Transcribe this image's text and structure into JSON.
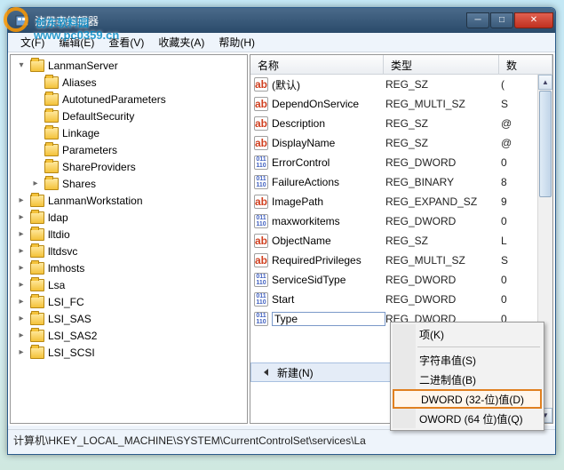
{
  "watermark": {
    "brand": "创东软料园",
    "url": "www.pc0359.cn"
  },
  "window": {
    "title": "注册表编辑器"
  },
  "menu": {
    "file": "文(F)",
    "edit": "编辑(E)",
    "view": "查看(V)",
    "favorites": "收藏夹(A)",
    "help": "帮助(H)"
  },
  "tree": [
    {
      "label": "LanmanServer",
      "exp": "▾",
      "cls": ""
    },
    {
      "label": "Aliases",
      "exp": "",
      "cls": "noexp",
      "indent": 1
    },
    {
      "label": "AutotunedParameters",
      "exp": "",
      "cls": "noexp",
      "indent": 1
    },
    {
      "label": "DefaultSecurity",
      "exp": "",
      "cls": "noexp",
      "indent": 1
    },
    {
      "label": "Linkage",
      "exp": "",
      "cls": "noexp",
      "indent": 1
    },
    {
      "label": "Parameters",
      "exp": "",
      "cls": "noexp",
      "indent": 1
    },
    {
      "label": "ShareProviders",
      "exp": "",
      "cls": "noexp",
      "indent": 1
    },
    {
      "label": "Shares",
      "exp": "▸",
      "cls": "",
      "indent": 1
    },
    {
      "label": "LanmanWorkstation",
      "exp": "▸",
      "cls": ""
    },
    {
      "label": "ldap",
      "exp": "▸",
      "cls": ""
    },
    {
      "label": "lltdio",
      "exp": "▸",
      "cls": ""
    },
    {
      "label": "lltdsvc",
      "exp": "▸",
      "cls": ""
    },
    {
      "label": "lmhosts",
      "exp": "▸",
      "cls": ""
    },
    {
      "label": "Lsa",
      "exp": "▸",
      "cls": ""
    },
    {
      "label": "LSI_FC",
      "exp": "▸",
      "cls": ""
    },
    {
      "label": "LSI_SAS",
      "exp": "▸",
      "cls": ""
    },
    {
      "label": "LSI_SAS2",
      "exp": "▸",
      "cls": ""
    },
    {
      "label": "LSI_SCSI",
      "exp": "▸",
      "cls": ""
    }
  ],
  "listheader": {
    "name": "名称",
    "type": "类型",
    "data": "数"
  },
  "rows": [
    {
      "icon": "ab",
      "name": "(默认)",
      "type": "REG_SZ",
      "data": "("
    },
    {
      "icon": "ab",
      "name": "DependOnService",
      "type": "REG_MULTI_SZ",
      "data": "S"
    },
    {
      "icon": "ab",
      "name": "Description",
      "type": "REG_SZ",
      "data": "@"
    },
    {
      "icon": "ab",
      "name": "DisplayName",
      "type": "REG_SZ",
      "data": "@"
    },
    {
      "icon": "bi",
      "name": "ErrorControl",
      "type": "REG_DWORD",
      "data": "0"
    },
    {
      "icon": "bi",
      "name": "FailureActions",
      "type": "REG_BINARY",
      "data": "8"
    },
    {
      "icon": "ab",
      "name": "ImagePath",
      "type": "REG_EXPAND_SZ",
      "data": "9"
    },
    {
      "icon": "bi",
      "name": "maxworkitems",
      "type": "REG_DWORD",
      "data": "0"
    },
    {
      "icon": "ab",
      "name": "ObjectName",
      "type": "REG_SZ",
      "data": "L"
    },
    {
      "icon": "ab",
      "name": "RequiredPrivileges",
      "type": "REG_MULTI_SZ",
      "data": "S"
    },
    {
      "icon": "bi",
      "name": "ServiceSidType",
      "type": "REG_DWORD",
      "data": "0"
    },
    {
      "icon": "bi",
      "name": "Start",
      "type": "REG_DWORD",
      "data": "0"
    },
    {
      "icon": "bi",
      "name": "Type",
      "type": "REG_DWORD",
      "data": "0",
      "edit": true
    }
  ],
  "context": {
    "new": "新建(N)"
  },
  "submenu": {
    "key": "项(K)",
    "string": "字符串值(S)",
    "binary": "二进制值(B)",
    "dword": "DWORD (32-位)值(D)",
    "qword": "OWORD (64 位)值(Q)"
  },
  "statusbar": "计算机\\HKEY_LOCAL_MACHINE\\SYSTEM\\CurrentControlSet\\services\\La"
}
